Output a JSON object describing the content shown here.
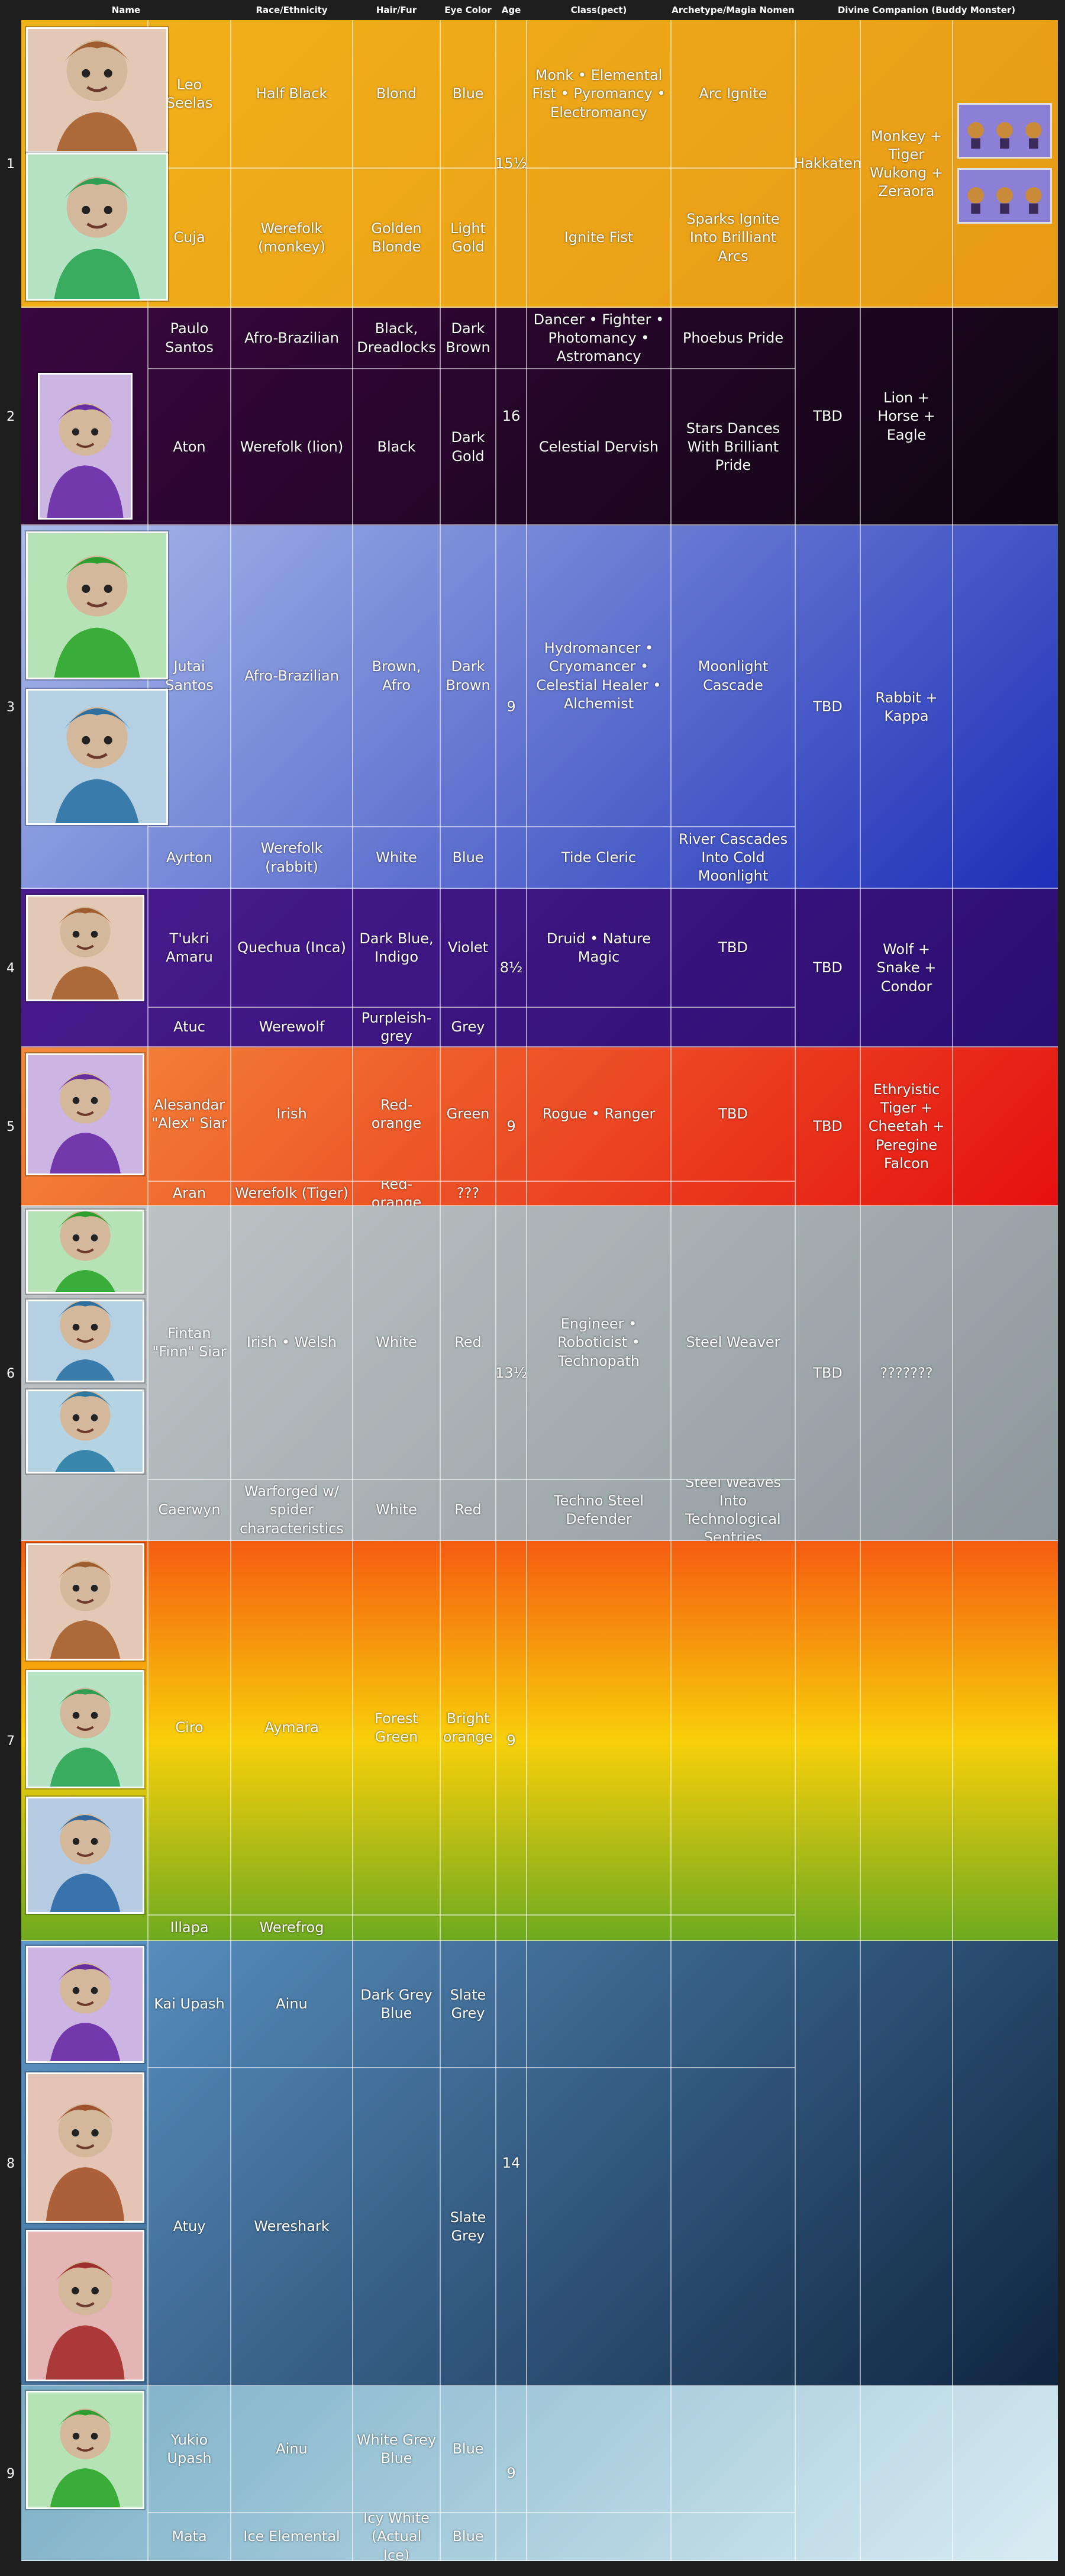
{
  "headers": {
    "name": "Name",
    "race": "Race/Ethnicity",
    "hair": "Hair/Fur",
    "eye": "Eye Color",
    "age": "Age",
    "cls": "Class(pect)",
    "arch": "Archetype/Magia Nomen",
    "divine": "Divine Companion (Buddy Monster)"
  },
  "colors": {
    "background": "#1e1e1e",
    "grid_line": "#ffffff"
  },
  "groups": [
    {
      "no": "1",
      "age": "15½",
      "guild": "Hakkaten",
      "companion": "Monkey + Tiger Wukong + Zeraora",
      "colors": [
        "#f2b21a",
        "#e79a16"
      ],
      "rows": [
        {
          "name": "Leo Seelas",
          "race": "Half Black",
          "hair": "Blond",
          "eye": "Blue",
          "cls": "Monk • Elemental Fist • Pyromancy • Electromancy",
          "arch": "Arc Ignite"
        },
        {
          "name": "Cuja",
          "race": "Werefolk (monkey)",
          "hair": "Golden Blonde",
          "eye": "Light Gold",
          "cls": "Ignite Fist",
          "arch": "Sparks Ignite Into Brilliant Arcs"
        }
      ]
    },
    {
      "no": "2",
      "age": "16",
      "guild": "TBD",
      "companion": "Lion + Horse + Eagle",
      "colors": [
        "#3a0740",
        "#0e0510"
      ],
      "rows": [
        {
          "name": "Paulo Santos",
          "race": "Afro-Brazilian",
          "hair": "Black, Dreadlocks",
          "eye": "Dark Brown",
          "cls": "Dancer • Fighter • Photomancy • Astromancy",
          "arch": "Phoebus Pride"
        },
        {
          "name": "Aton",
          "race": "Werefolk (lion)",
          "hair": "Black",
          "eye": "Dark Gold",
          "cls": "Celestial Dervish",
          "arch": "Stars Dances With Brilliant Pride"
        }
      ]
    },
    {
      "no": "3",
      "age": "9",
      "guild": "TBD",
      "companion": "Rabbit + Kappa",
      "colors": [
        "#a9bbea",
        "#1e2fb8"
      ],
      "rows": [
        {
          "name": "Jutai Santos",
          "race": "Afro-Brazilian",
          "hair": "Brown, Afro",
          "eye": "Dark Brown",
          "cls": "Hydromancer • Cryomancer • Celestial Healer • Alchemist",
          "arch": "Moonlight Cascade"
        },
        {
          "name": "Ayrton",
          "race": "Werefolk (rabbit)",
          "hair": "White",
          "eye": "Blue",
          "cls": "Tide Cleric",
          "arch": "River Cascades Into Cold Moonlight"
        }
      ]
    },
    {
      "no": "4",
      "age": "8½",
      "guild": "TBD",
      "companion": "Wolf + Snake + Condor",
      "colors": [
        "#4a1c8e",
        "#2a0e72"
      ],
      "rows": [
        {
          "name": "T'ukri Amaru",
          "race": "Quechua (Inca)",
          "hair": "Dark Blue, Indigo",
          "eye": "Violet",
          "cls": "Druid • Nature Magic",
          "arch": "TBD"
        },
        {
          "name": "Atuc",
          "race": "Werewolf",
          "hair": "Purpleish-grey",
          "eye": "Grey",
          "cls": "",
          "arch": ""
        }
      ]
    },
    {
      "no": "5",
      "age": "9",
      "guild": "TBD",
      "companion": "Ethryistic Tiger + Cheetah + Peregine Falcon",
      "colors": [
        "#f48a3a",
        "#e51010"
      ],
      "rows": [
        {
          "name": "Alesandar \"Alex\" Siar",
          "race": "Irish",
          "hair": "Red-orange",
          "eye": "Green",
          "cls": "Rogue • Ranger",
          "arch": "TBD"
        },
        {
          "name": "Aran",
          "race": "Werefolk (Tiger)",
          "hair": "Red-orange",
          "eye": "???",
          "cls": "",
          "arch": ""
        }
      ]
    },
    {
      "no": "6",
      "age": "13½",
      "guild": "TBD",
      "companion": "???????",
      "colors": [
        "#c2c7c9",
        "#8d989c"
      ],
      "rows": [
        {
          "name": "Fintan \"Finn\" Siar",
          "race": "Irish • Welsh",
          "hair": "White",
          "eye": "Red",
          "cls": "Engineer • Roboticist • Technopath",
          "arch": "Steel Weaver"
        },
        {
          "name": "Caerwyn",
          "race": "Warforged w/ spider characteristics",
          "hair": "White",
          "eye": "Red",
          "cls": "Techno Steel Defender",
          "arch": "Steel Weaves Into Technological Sentries"
        }
      ]
    },
    {
      "no": "7",
      "age": "9",
      "guild": "",
      "companion": "",
      "colors": [
        "#f55c10",
        "#f8cf0a",
        "#6eaa20"
      ],
      "rows": [
        {
          "name": "Ciro",
          "race": "Aymara",
          "hair": "Forest Green",
          "eye": "Bright orange",
          "cls": "",
          "arch": ""
        },
        {
          "name": "Illapa",
          "race": "Werefrog",
          "hair": "",
          "eye": "",
          "cls": "",
          "arch": ""
        }
      ]
    },
    {
      "no": "8",
      "age": "14",
      "guild": "",
      "companion": "",
      "colors": [
        "#5d96c8",
        "#0f2540"
      ],
      "rows": [
        {
          "name": "Kai Upash",
          "race": "Ainu",
          "hair": "Dark Grey Blue",
          "eye": "Slate Grey",
          "cls": "",
          "arch": ""
        },
        {
          "name": "Atuy",
          "race": "Wereshark",
          "hair": "",
          "eye": "Slate Grey",
          "cls": "",
          "arch": ""
        }
      ]
    },
    {
      "no": "9",
      "age": "9",
      "guild": "",
      "companion": "",
      "colors": [
        "#7aaec6",
        "#d8ecf2"
      ],
      "rows": [
        {
          "name": "Yukio Upash",
          "race": "Ainu",
          "hair": "White Grey Blue",
          "eye": "Blue",
          "cls": "",
          "arch": ""
        },
        {
          "name": "Mata",
          "race": "Ice Elemental",
          "hair": "Icy White (Actual Ice)",
          "eye": "Blue",
          "cls": "",
          "arch": ""
        }
      ]
    }
  ]
}
